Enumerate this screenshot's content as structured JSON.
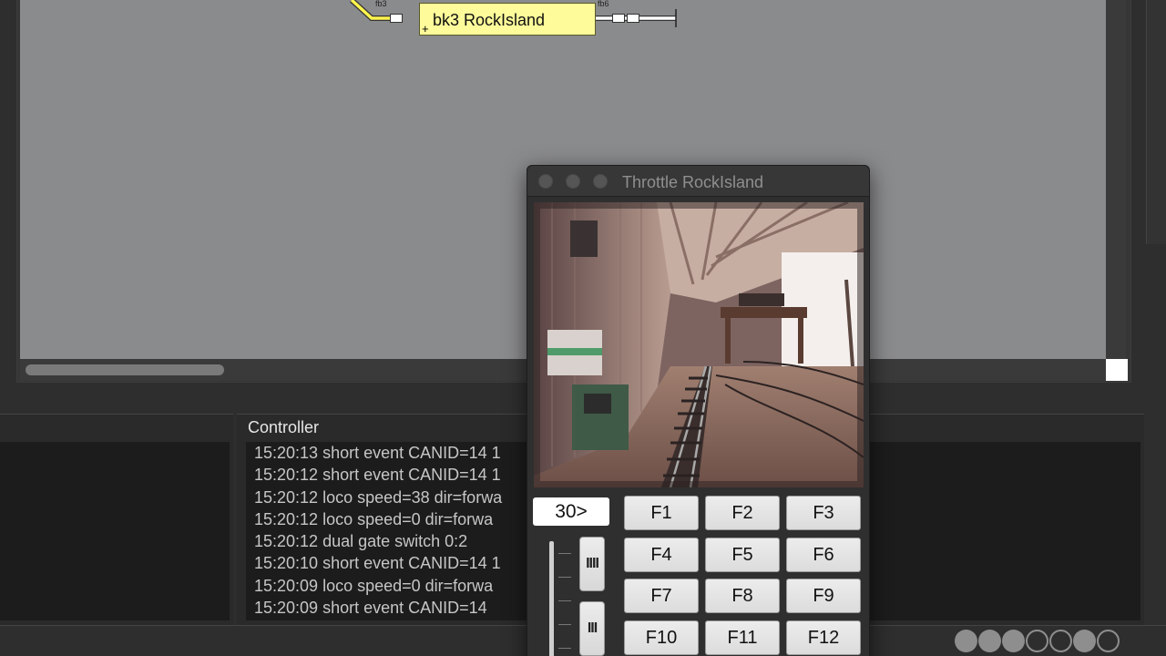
{
  "plan": {
    "block_label": "bk3 RockIsland",
    "block_marker": "+",
    "fb_left": "fb3",
    "fb_right": "fb6"
  },
  "controller": {
    "title": "Controller",
    "log": [
      "15:20:13 short event CANID=14 1",
      "15:20:12 short event CANID=14 1",
      "15:20:12 loco speed=38 dir=forwa",
      "15:20:12 loco speed=0 dir=forwa",
      "15:20:12 dual gate switch 0:2",
      "15:20:10 short event CANID=14 1",
      "15:20:09 loco speed=0 dir=forwa",
      "15:20:09 short event CANID=14"
    ]
  },
  "throttle": {
    "title": "Throttle RockIsland",
    "speed_display": "30>",
    "functions": [
      "F1",
      "F2",
      "F3",
      "F4",
      "F5",
      "F6",
      "F7",
      "F8",
      "F9",
      "F10",
      "F11",
      "F12"
    ],
    "dir_forward_label": "IIII",
    "dir_reverse_label": "III"
  },
  "status_leds": [
    "on",
    "on",
    "on",
    "off",
    "off",
    "on",
    "off"
  ],
  "colors": {
    "block_fill": "#fdfb9a",
    "plan_bg": "#8a8b8d",
    "track": "#fff44f"
  }
}
